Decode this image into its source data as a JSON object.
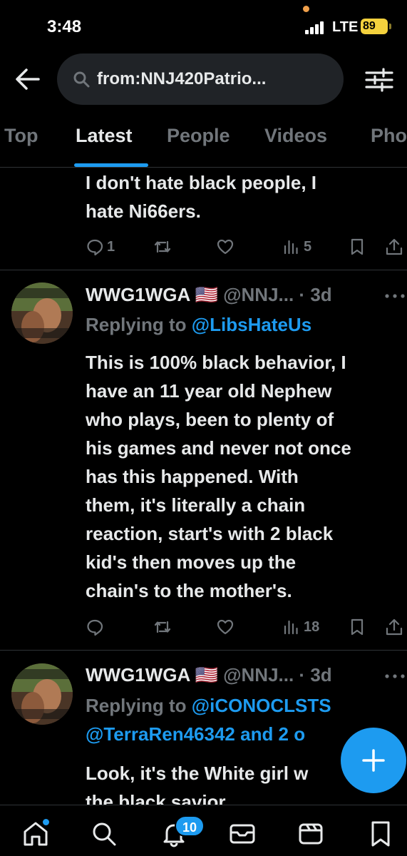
{
  "status_bar": {
    "time": "3:48",
    "network": "LTE",
    "battery": "89"
  },
  "search": {
    "query": "from:NNJ420Patrio..."
  },
  "tabs": [
    {
      "label": "Top"
    },
    {
      "label": "Latest"
    },
    {
      "label": "People"
    },
    {
      "label": "Videos"
    },
    {
      "label": "Pho"
    }
  ],
  "tweets": [
    {
      "text_lines": [
        "I don't hate black people, I",
        "hate Ni66ers."
      ],
      "replies": "1",
      "views": "5"
    },
    {
      "name": "WWG1WGA 🇺🇸",
      "handle": "@NNJ... · 3d",
      "replying_prefix": "Replying to ",
      "replying_to": "@LibsHateUs",
      "text_lines": [
        "This is 100% black behavior, I",
        "have an 11 year old Nephew",
        "who plays, been to plenty of",
        "his games and never not once",
        "has this happened. With",
        "them, it's literally a chain",
        "reaction, start's with 2 black",
        "kid's then moves up the",
        "chain's to the mother's."
      ],
      "views": "18"
    },
    {
      "name": "WWG1WGA 🇺🇸",
      "handle": "@NNJ... · 3d",
      "replying_prefix": "Replying to ",
      "replying_to": "@iCONOCLSTS",
      "replying_to_2": "@TerraRen46342 and 2 o",
      "text_lines": [
        "Look, it's the White girl w",
        "the black savior"
      ]
    }
  ],
  "bottom_nav": {
    "notifications_badge": "10"
  },
  "colors": {
    "accent": "#1d9bf0",
    "muted": "#71767b",
    "background": "#000000"
  }
}
